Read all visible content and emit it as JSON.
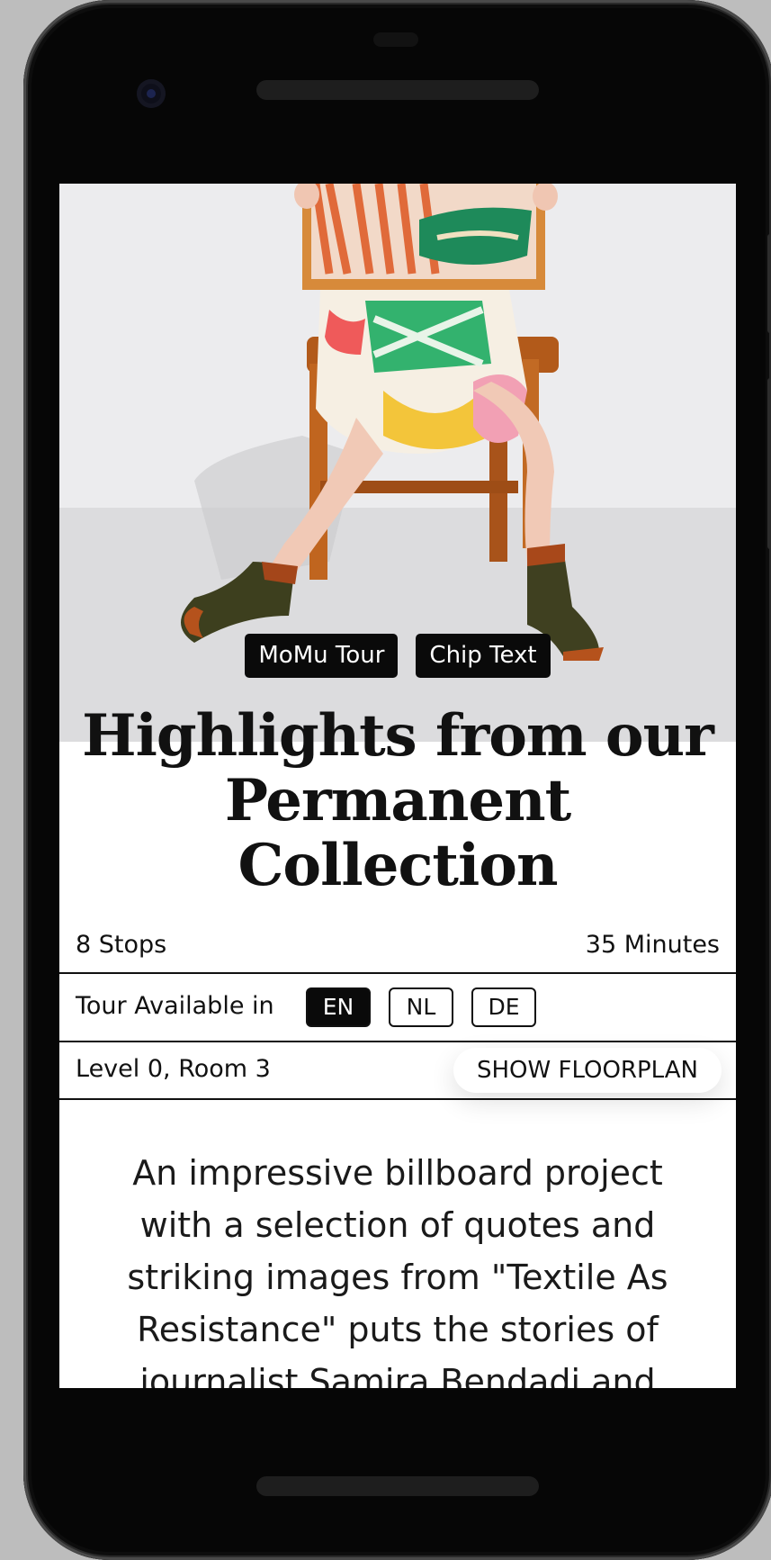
{
  "tour": {
    "chips": [
      "MoMu Tour",
      "Chip Text"
    ],
    "title": "Highlights from our Permanent Collection",
    "stops": "8 Stops",
    "duration": "35 Minutes",
    "languages_label": "Tour Available in",
    "languages": [
      {
        "code": "EN",
        "selected": true
      },
      {
        "code": "NL",
        "selected": false
      },
      {
        "code": "DE",
        "selected": false
      }
    ],
    "location": "Level 0, Room 3",
    "floorplan_button": "SHOW FLOORPLAN",
    "description": "An impressive billboard project with a selection of quotes and striking images from \"Textile As Resistance\" puts the stories of journalist Samira Bendadi and"
  },
  "colors": {
    "chip_bg": "#0a0a0a",
    "accent_text": "#111111",
    "screen_bg": "#ffffff",
    "device": "#060606"
  }
}
